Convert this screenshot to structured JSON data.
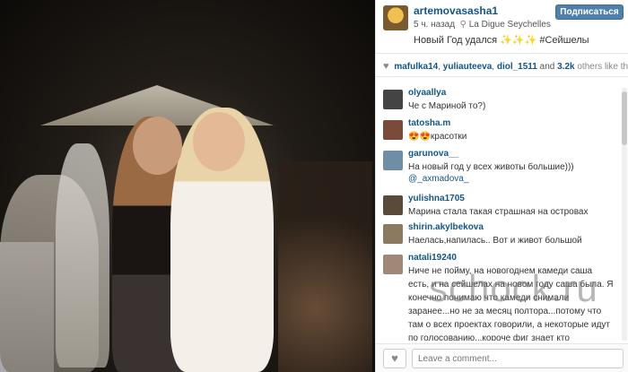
{
  "post": {
    "username": "artemovasasha1",
    "time": "5 ч. назад",
    "location": "La Digue Seychelles",
    "caption": "Новый Год удался ✨✨✨ #Сейшелы",
    "follow_label": "Подписаться"
  },
  "likes": {
    "users": [
      "mafulka14",
      "yuliauteeva",
      "diol_1511"
    ],
    "count": "3.2k",
    "suffix": "others like this."
  },
  "comments": [
    {
      "user": "olyaallya",
      "text": "Че с Мариной то?)"
    },
    {
      "user": "tatosha.m",
      "text": "😍😍красотки"
    },
    {
      "user": "garunova__",
      "text": "На новый год у всех животы большие)))",
      "mention": "@_axmadova_"
    },
    {
      "user": "yulishna1705",
      "text": "Марина стала такая страшная на островах"
    },
    {
      "user": "shirin.akylbekova",
      "text": "Наелась,напилась.. Вот и живот большой"
    },
    {
      "user": "natali19240",
      "text": "Ниче не пойму, на новогоднем камеди саша есть, и на сейшелах на новом году саша была. Я конечно понимаю что камеди снимали заранее...но не за месяц полтора...потому что там о всех проектах говорили, а некоторые идут по голосованию...короче фиг знает кто"
    }
  ],
  "footer": {
    "input_placeholder": "Leave a comment..."
  },
  "watermark": "schock.ru",
  "colors": {
    "link": "#125688",
    "follow_button": "#4f80ab"
  }
}
